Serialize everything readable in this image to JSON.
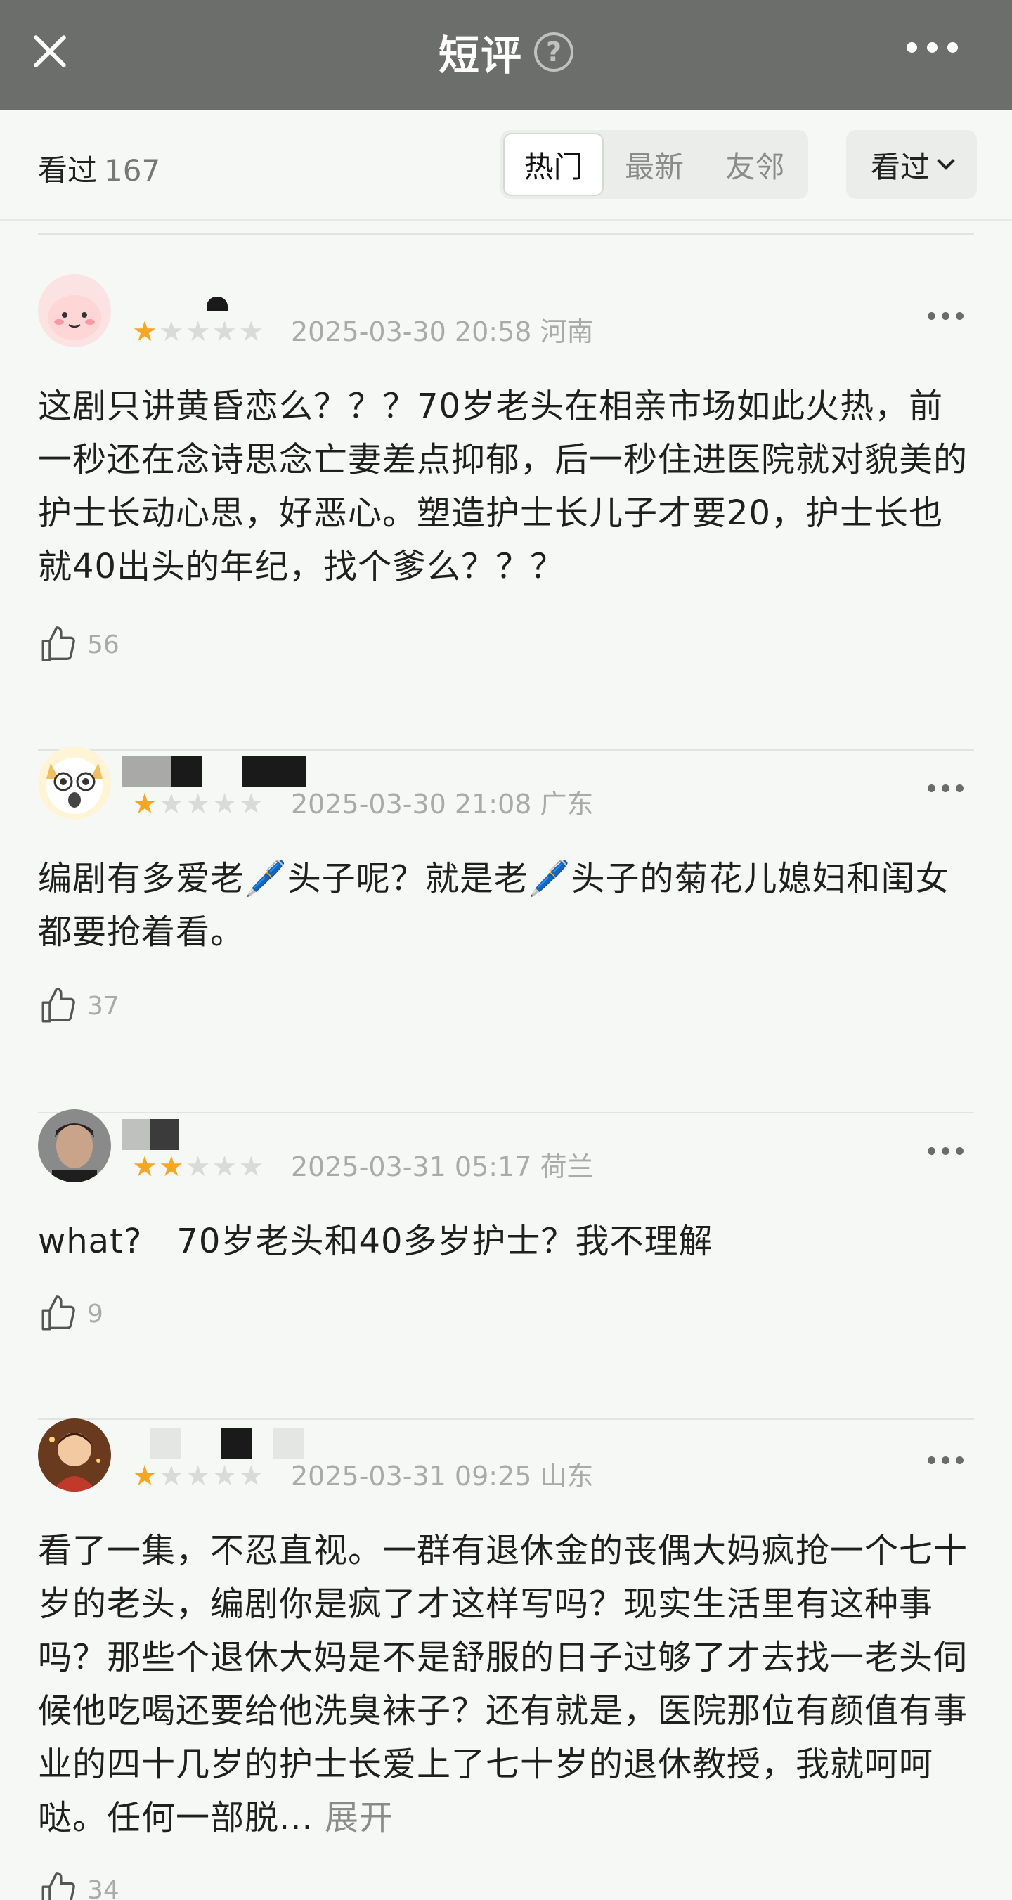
{
  "header": {
    "title": "短评",
    "help_icon": "question-circle-icon",
    "close_icon": "close-icon",
    "more_icon": "more-horizontal-icon"
  },
  "filter": {
    "seen_label": "看过",
    "seen_count": "167",
    "tabs": [
      "热门",
      "最新",
      "友邻"
    ],
    "active_tab": "热门",
    "dropdown_label": "看过"
  },
  "colors": {
    "header_bg": "#6b6e6b",
    "star_on": "#f5a623",
    "star_off": "#d9dbd8"
  },
  "comments": [
    {
      "rating": 1,
      "date": "2025-03-30 20:58",
      "location": "河南",
      "text": "这剧只讲黄昏恋么？？？70岁老头在相亲市场如此火热，前一秒还在念诗思念亡妻差点抑郁，后一秒住进医院就对貌美的护士长动心思，好恶心。塑造护士长儿子才要20，护士长也就40出头的年纪，找个爹么？？？",
      "likes": "56"
    },
    {
      "rating": 1,
      "date": "2025-03-30 21:08",
      "location": "广东",
      "text": "编剧有多爱老🖊️头子呢？就是老🖊️头子的菊花儿媳妇和闺女都要抢着看。",
      "likes": "37"
    },
    {
      "rating": 2,
      "date": "2025-03-31 05:17",
      "location": "荷兰",
      "text": "what?　70岁老头和40多岁护士？我不理解",
      "likes": "9"
    },
    {
      "rating": 1,
      "date": "2025-03-31 09:25",
      "location": "山东",
      "text": "看了一集，不忍直视。一群有退休金的丧偶大妈疯抢一个七十岁的老头，编剧你是疯了才这样写吗？现实生活里有这种事吗？那些个退休大妈是不是舒服的日子过够了才去找一老头伺候他吃喝还要给他洗臭袜子？还有就是，医院那位有颜值有事业的四十几岁的护士长爱上了七十岁的退休教授，我就呵呵哒。任何一部脱...",
      "expand": "展开",
      "likes": "34"
    }
  ]
}
